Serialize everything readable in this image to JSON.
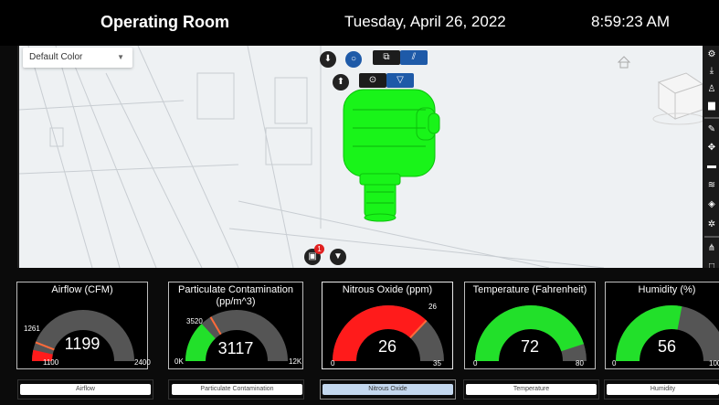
{
  "header": {
    "title": "Operating Room",
    "date": "Tuesday, April 26, 2022",
    "time": "8:59:23 AM"
  },
  "viewer": {
    "color_dropdown": "Default Color",
    "badge_count": "1"
  },
  "gauges": [
    {
      "title": "Airflow (CFM)",
      "value": "1199",
      "min": "1100",
      "max": "2400",
      "mark": "1261",
      "fill": 0.07,
      "color": "#ff1b1b"
    },
    {
      "title": "Particulate Contamination (pp/m^3)",
      "value": "3117",
      "min": "0K",
      "max": "12K",
      "mark": "3520",
      "fill": 0.26,
      "color": "#22e02a"
    },
    {
      "title": "Nitrous Oxide (ppm)",
      "value": "26",
      "min": "0",
      "max": "35",
      "mark": "26",
      "fill": 0.74,
      "color": "#ff1b1b"
    },
    {
      "title": "Temperature (Fahrenheit)",
      "value": "72",
      "min": "0",
      "max": "80",
      "fill": 0.9,
      "color": "#22e02a"
    },
    {
      "title": "Humidity (%)",
      "value": "56",
      "min": "0",
      "max": "100",
      "fill": 0.56,
      "color": "#22e02a"
    }
  ],
  "buttons": [
    "Airflow",
    "Particulate Contamination",
    "Nitrous Oxide",
    "Temperature",
    "Humidity"
  ],
  "colors": {
    "gauge_track": "#555555",
    "marker": "#ff6a3a",
    "model_green": "#19f419",
    "active_button": "#c4d8ef"
  }
}
